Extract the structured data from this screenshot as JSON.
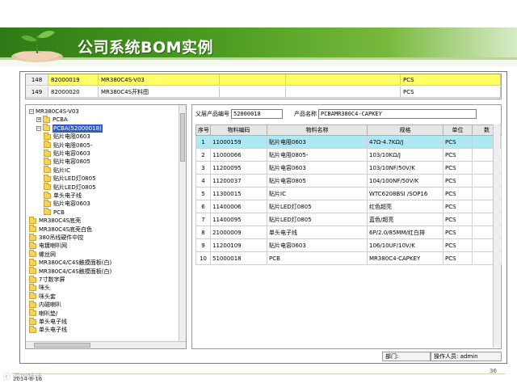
{
  "slide": {
    "title": "公司系统BOM实例",
    "date": "2014-8-16",
    "page_number": "36",
    "watermark": "ⓒ 深圳特话"
  },
  "colors": {
    "header_green": "#4f9e22",
    "highlight_yellow": "#ffff66",
    "selection_cyan": "#aee8f5",
    "tree_selection_blue": "#2e5bd3"
  },
  "top_grid": {
    "rows": [
      {
        "index": "148",
        "code": "82000019",
        "name": "MR380C4S-V03",
        "unit": "PCS",
        "highlighted": true
      },
      {
        "index": "149",
        "code": "82000020",
        "name": "MR380C4S开料图",
        "unit": "PCS",
        "highlighted": false
      }
    ]
  },
  "tree": {
    "items": [
      {
        "label": "MR380C4S-V03",
        "indent": 0,
        "expander": "−",
        "folder": false,
        "selected": false
      },
      {
        "label": "PCBA",
        "indent": 1,
        "expander": "+",
        "folder": true,
        "selected": false
      },
      {
        "label": "PCBA(52000018)",
        "indent": 1,
        "expander": "−",
        "folder": true,
        "selected": true
      },
      {
        "label": "贴片电阻0603",
        "indent": 2,
        "expander": "",
        "folder": true,
        "selected": false
      },
      {
        "label": "贴片电阻0805-",
        "indent": 2,
        "expander": "",
        "folder": true,
        "selected": false
      },
      {
        "label": "贴片电容0603",
        "indent": 2,
        "expander": "",
        "folder": true,
        "selected": false
      },
      {
        "label": "贴片电容0805",
        "indent": 2,
        "expander": "",
        "folder": true,
        "selected": false
      },
      {
        "label": "贴片IC",
        "indent": 2,
        "expander": "",
        "folder": true,
        "selected": false
      },
      {
        "label": "贴片LED灯0805",
        "indent": 2,
        "expander": "",
        "folder": true,
        "selected": false
      },
      {
        "label": "贴片LED灯0805",
        "indent": 2,
        "expander": "",
        "folder": true,
        "selected": false
      },
      {
        "label": "单头电子线",
        "indent": 2,
        "expander": "",
        "folder": true,
        "selected": false
      },
      {
        "label": "贴片电容0603",
        "indent": 2,
        "expander": "",
        "folder": true,
        "selected": false
      },
      {
        "label": "PCB",
        "indent": 2,
        "expander": "",
        "folder": true,
        "selected": false
      },
      {
        "label": "MR380C4S底壳",
        "indent": 0,
        "expander": "",
        "folder": true,
        "selected": false
      },
      {
        "label": "MR380C4S底壳白色",
        "indent": 0,
        "expander": "",
        "folder": true,
        "selected": false
      },
      {
        "label": "380吊线硬件中控",
        "indent": 0,
        "expander": "",
        "folder": true,
        "selected": false
      },
      {
        "label": "电镀喇叭网",
        "indent": 0,
        "expander": "",
        "folder": true,
        "selected": false
      },
      {
        "label": "螺丝网",
        "indent": 0,
        "expander": "",
        "folder": true,
        "selected": false
      },
      {
        "label": "MR380C4/C4S触摸面板(白)",
        "indent": 0,
        "expander": "",
        "folder": true,
        "selected": false
      },
      {
        "label": "MR380C4/C4S触摸面板(白)",
        "indent": 0,
        "expander": "",
        "folder": true,
        "selected": false
      },
      {
        "label": "7寸数字屏",
        "indent": 0,
        "expander": "",
        "folder": true,
        "selected": false
      },
      {
        "label": "咪头",
        "indent": 0,
        "expander": "",
        "folder": true,
        "selected": false
      },
      {
        "label": "咪头套",
        "indent": 0,
        "expander": "",
        "folder": true,
        "selected": false
      },
      {
        "label": "内磁喇叭",
        "indent": 0,
        "expander": "",
        "folder": true,
        "selected": false
      },
      {
        "label": "喇叭垫/",
        "indent": 0,
        "expander": "",
        "folder": true,
        "selected": false
      },
      {
        "label": "单头电子线",
        "indent": 0,
        "expander": "",
        "folder": true,
        "selected": false
      },
      {
        "label": "单头电子线",
        "indent": 0,
        "expander": "",
        "folder": true,
        "selected": false
      }
    ]
  },
  "detail": {
    "parent_code_label": "父层产品编号",
    "parent_code_value": "52000018",
    "product_name_label": "产品名称",
    "product_name_value": "PCBAMR380C4-CAPKEY",
    "columns": [
      "序号",
      "物料编码",
      "物料名称",
      "规格",
      "单位",
      "数"
    ],
    "rows": [
      {
        "no": "1",
        "code": "11000159",
        "name": "贴片电阻0603",
        "spec": "47Ω-4.7KΩ/J",
        "unit": "PCS",
        "selected": true
      },
      {
        "no": "2",
        "code": "11000066",
        "name": "贴片电阻0805-",
        "spec": "103/10KΩ/J",
        "unit": "PCS",
        "selected": false
      },
      {
        "no": "3",
        "code": "11200095",
        "name": "贴片电容0603",
        "spec": "103/10NF/50V/K",
        "unit": "PCS",
        "selected": false
      },
      {
        "no": "4",
        "code": "11200037",
        "name": "贴片电容0805",
        "spec": "104/100NF/50V/K",
        "unit": "PCS",
        "selected": false
      },
      {
        "no": "5",
        "code": "11300015",
        "name": "贴片IC",
        "spec": "WTC6208BSI    /SOP16",
        "unit": "PCS",
        "selected": false
      },
      {
        "no": "6",
        "code": "11400006",
        "name": "贴片LED灯0805",
        "spec": "红色超亮",
        "unit": "PCS",
        "selected": false
      },
      {
        "no": "7",
        "code": "11400095",
        "name": "贴片LED灯0805",
        "spec": "蓝色/超亮",
        "unit": "PCS",
        "selected": false
      },
      {
        "no": "8",
        "code": "21000009",
        "name": "单头电子线",
        "spec": "6P/2.0/85MM/红白排",
        "unit": "PCS",
        "selected": false
      },
      {
        "no": "9",
        "code": "11200109",
        "name": "贴片电容0603",
        "spec": "106/10UF/10V/K",
        "unit": "PCS",
        "selected": false
      },
      {
        "no": "10",
        "code": "51000018",
        "name": "PCB",
        "spec": "MR380C4-CAPKEY",
        "unit": "PCS",
        "selected": false
      }
    ]
  },
  "status_bar": {
    "dept_label": "部门:",
    "operator_label": "操作人员: admin"
  }
}
